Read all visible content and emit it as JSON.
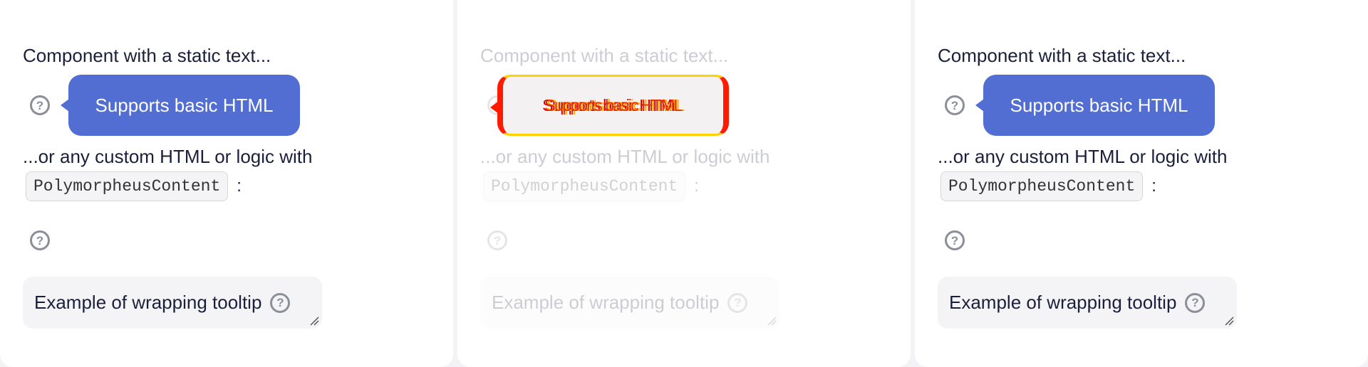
{
  "demo": {
    "static_text": "Component with a static text...",
    "tooltip_text": "Supports basic HTML",
    "custom_text": "...or any custom HTML or logic with",
    "code_label": "PolymorpheusContent",
    "colon": ":",
    "textarea_text": "Example of wrapping tooltip"
  },
  "icons": {
    "help": "question-circle-icon",
    "resize": "resize-handle-icon"
  },
  "colors": {
    "tooltip_bg": "#526ed3",
    "icon": "#8c8e99",
    "text": "#1b1f3b",
    "glitch_red": "#ff1a00",
    "glitch_yellow": "#ffd100"
  }
}
